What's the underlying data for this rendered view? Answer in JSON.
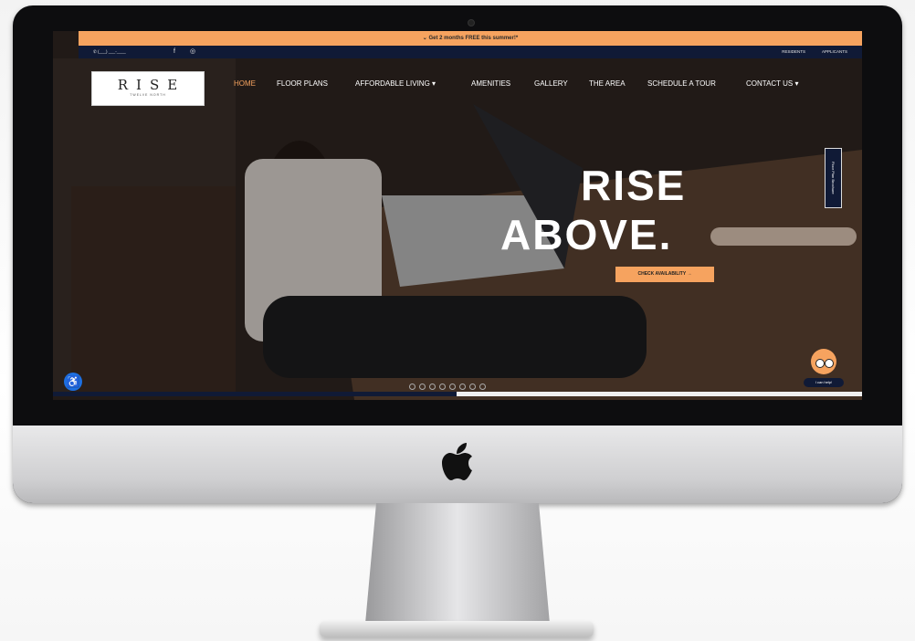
{
  "promo_bar": {
    "text": "⌄ Get 2 months FREE this summer!*"
  },
  "utility_bar": {
    "phone": "(___) ___-____",
    "facebook_icon": "facebook-icon",
    "instagram_icon": "instagram-icon",
    "residents_link": "RESIDENTS",
    "applicants_link": "APPLICANTS"
  },
  "logo": {
    "name": "RISE",
    "tagline": "TWELVE NORTH"
  },
  "nav": {
    "items": [
      {
        "label": "HOME",
        "active": true
      },
      {
        "label": "FLOOR PLANS"
      },
      {
        "label": "AFFORDABLE LIVING ▾"
      },
      {
        "label": "AMENITIES"
      },
      {
        "label": "GALLERY"
      },
      {
        "label": "THE AREA"
      },
      {
        "label": "SCHEDULE A TOUR"
      },
      {
        "label": "CONTACT US ▾"
      }
    ]
  },
  "hero": {
    "title_line1": "RISE",
    "title_line2": "ABOVE.",
    "cta_label": "CHECK AVAILABILITY →",
    "slide_count": 8
  },
  "side_tab": {
    "label": "Floor Plan Brochure"
  },
  "chat_widget": {
    "label": "I can help!"
  },
  "accessibility": {
    "icon": "accessibility-icon"
  },
  "colors": {
    "accent": "#f6a35f",
    "navy": "#101a36",
    "active_nav": "#f6a35f"
  }
}
